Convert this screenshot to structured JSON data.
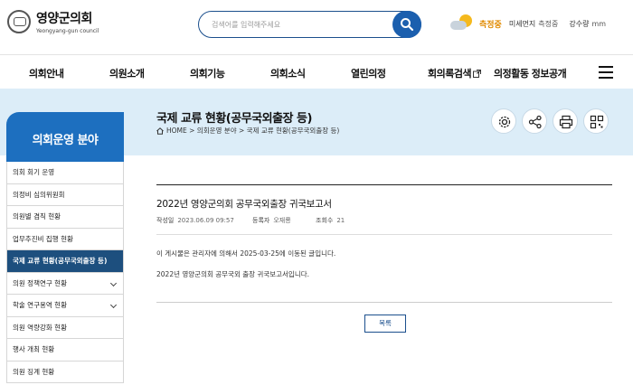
{
  "header": {
    "logo_title": "영양군의회",
    "logo_subtitle": "Yeongyang-gun council",
    "search_placeholder": "검색어를 입력해주세요",
    "weather_status": "측정중",
    "dust_label": "미세먼지",
    "dust_value": "측정중",
    "rain_label": "강수량",
    "rain_value": "mm"
  },
  "nav": {
    "items": [
      "의회안내",
      "의원소개",
      "의회기능",
      "의회소식",
      "열린의정",
      "회의록검색",
      "의정활동 정보공개"
    ]
  },
  "page": {
    "title": "국제 교류 현황(공무국외출장 등)",
    "breadcrumb": "HOME > 의회운영 분야 > 국제 교류 현황(공무국외출장 등)"
  },
  "sidebar": {
    "title": "의회운영 분야",
    "items": [
      {
        "label": "의회 회기 운영"
      },
      {
        "label": "의정비 심의위원회"
      },
      {
        "label": "의원별 겸직 현황"
      },
      {
        "label": "업무추진비 집행 현황"
      },
      {
        "label": "국제 교류 현황(공무국외출장 등)"
      },
      {
        "label": "의원 정책연구 현황"
      },
      {
        "label": "학술 연구용역 현황"
      },
      {
        "label": "의원 역량강화 현황"
      },
      {
        "label": "행사 개최 현황"
      },
      {
        "label": "의원 징계 현황"
      }
    ]
  },
  "post": {
    "title": "2022년 영양군의회 공무국외출장 귀국보고서",
    "date_label": "작성일",
    "date_value": "2023.06.09 09:57",
    "author_label": "등록자",
    "author_value": "오재룡",
    "views_label": "조회수",
    "views_value": "21",
    "notice": "이 게시물은 관리자에 의해서 2025-03-25에 이동된 글입니다.",
    "body": "2022년 영양군의회 공무국외 출장 귀국보고서입니다.",
    "list_button": "목록"
  },
  "colors": {
    "primary": "#1b5fae",
    "sidebar_head": "#1d6fbf",
    "sidebar_active": "#1d4f7e",
    "banner_bg": "#dcedf8",
    "weather_status": "#e08a00"
  },
  "icons": [
    "search-icon",
    "sun-cloud-icon",
    "hamburger-icon",
    "home-icon",
    "settings-icon",
    "share-icon",
    "print-icon",
    "qr-code-icon",
    "external-link-icon",
    "chevron-down-icon"
  ]
}
